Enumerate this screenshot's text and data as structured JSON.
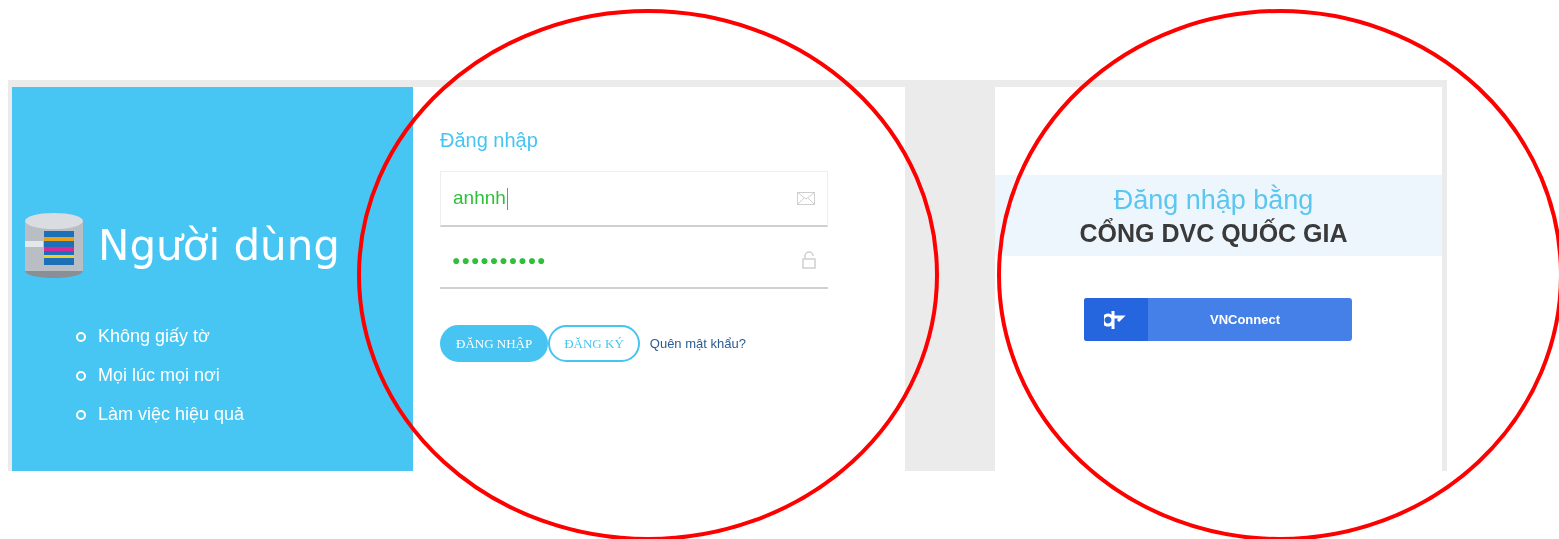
{
  "brand": {
    "title": "Người dùng"
  },
  "features": [
    "Không giấy tờ",
    "Mọi lúc mọi nơi",
    "Làm việc hiệu quả"
  ],
  "login": {
    "title": "Đăng nhập",
    "fields": [
      {
        "kind": "email",
        "value": "anhnh",
        "focused": true
      },
      {
        "kind": "password",
        "value": "●●●●●●●●●●",
        "focused": false
      }
    ],
    "buttons": [
      {
        "label": "ĐĂNG NHẬP",
        "kind": "primary"
      },
      {
        "label": "ĐĂNG KÝ",
        "kind": "outline"
      }
    ],
    "link": "Quên mật khẩu?"
  },
  "portal": {
    "title": "Đăng nhập bằng",
    "subtitle": "CỔNG DVC QUỐC GIA",
    "button": "VNConnect"
  }
}
